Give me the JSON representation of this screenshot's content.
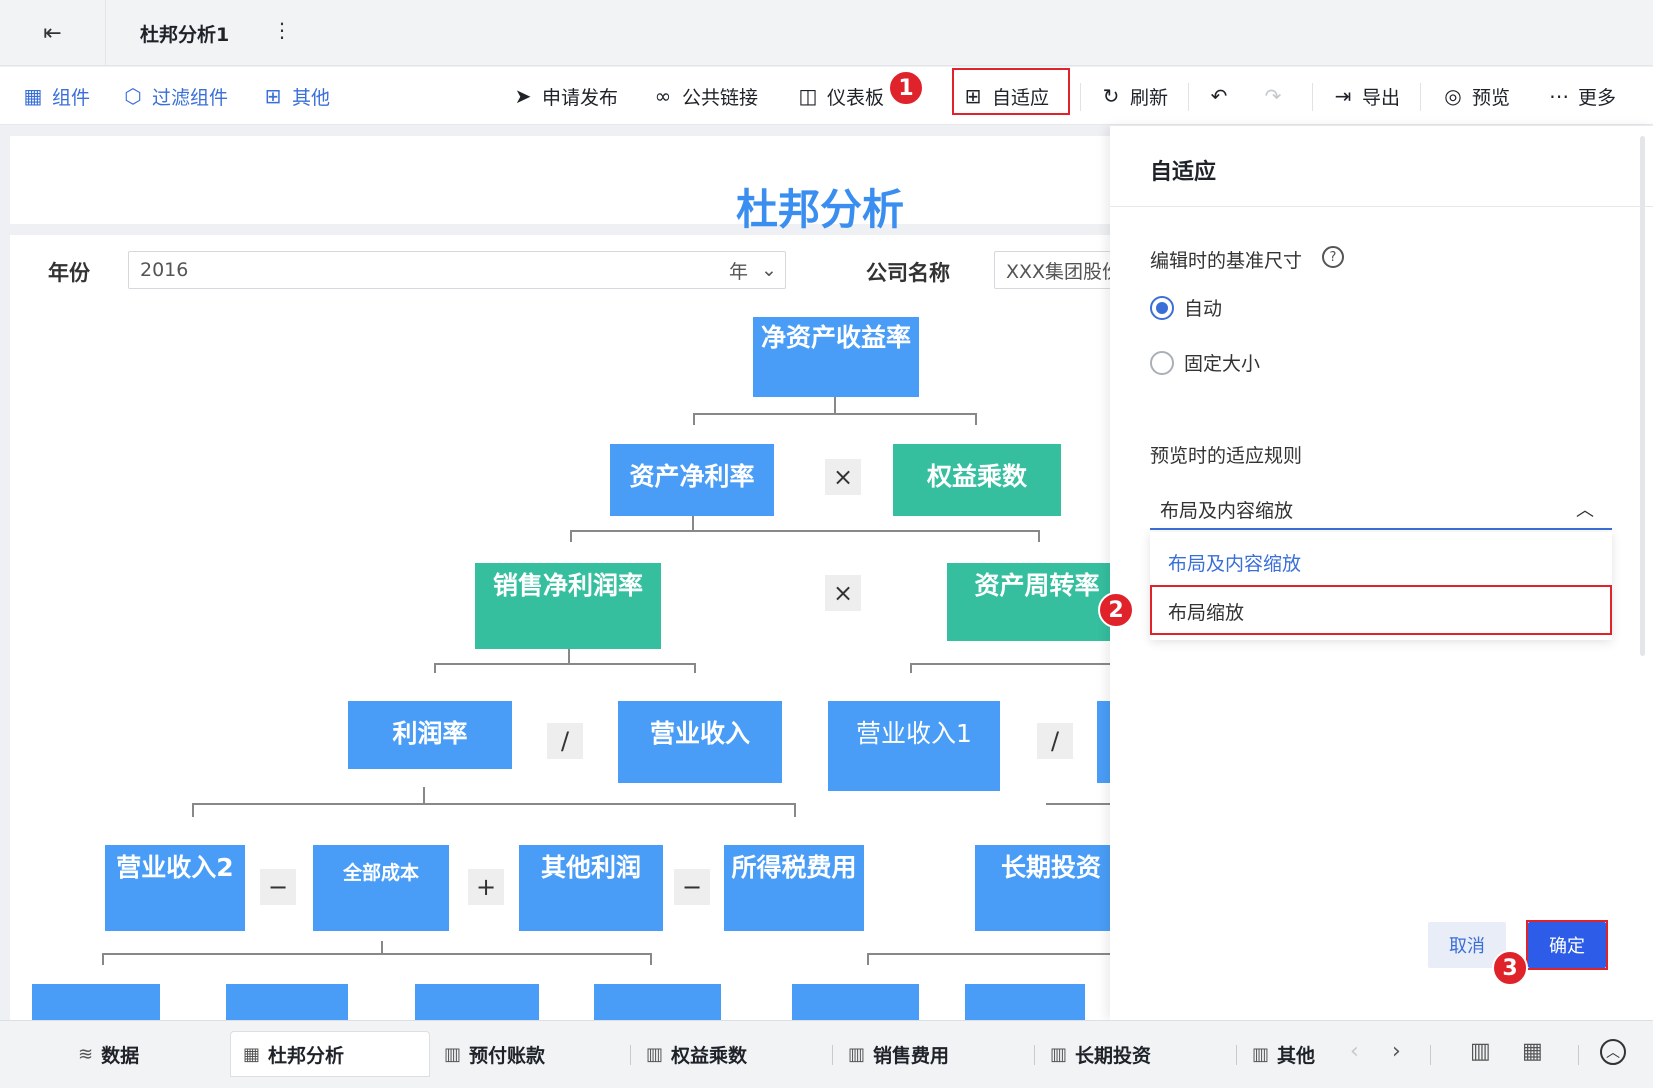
{
  "titlebar": {
    "back_icon": "exit-icon",
    "doc_title": "杜邦分析1",
    "more": "⋮"
  },
  "toolbar": {
    "components": "组件",
    "filter_components": "过滤组件",
    "others": "其他",
    "publish": "申请发布",
    "public_link": "公共链接",
    "dashboard": "仪表板",
    "adaptive": "自适应",
    "refresh": "刷新",
    "export": "导出",
    "preview": "预览",
    "more": "更多"
  },
  "report": {
    "title": "杜邦分析",
    "filters": {
      "year_label": "年份",
      "year_value": "2016",
      "year_unit": "年",
      "company_label": "公司名称",
      "company_value": "XXX集团股份"
    },
    "nodes": {
      "roe": "净资产收益率",
      "roa": "资产净利率",
      "equity_multiplier": "权益乘数",
      "net_margin": "销售净利润率",
      "asset_turnover": "资产周转率",
      "profit_rate": "利润率",
      "revenue": "营业收入",
      "revenue1": "营业收入1",
      "revenue2": "营业收入2",
      "total_cost": "全部成本",
      "other_profit": "其他利润",
      "income_tax": "所得税费用",
      "lt_invest": "长期投资"
    },
    "ops": {
      "multiply": "×",
      "divide": "/",
      "minus": "−",
      "plus": "+"
    }
  },
  "panel": {
    "title": "自适应",
    "base_size_label": "编辑时的基准尺寸",
    "radio_auto": "自动",
    "radio_fixed": "固定大小",
    "preview_rule_label": "预览时的适应规则",
    "select_value": "布局及内容缩放",
    "options": [
      "布局及内容缩放",
      "布局缩放"
    ],
    "cancel": "取消",
    "confirm": "确定"
  },
  "steps": [
    "1",
    "2",
    "3"
  ],
  "bottom_tabs": [
    "数据",
    "杜邦分析",
    "预付账款",
    "权益乘数",
    "销售费用",
    "长期投资",
    "其他"
  ],
  "colors": {
    "accent": "#3a6fd8",
    "node_blue": "#4a9df7",
    "node_green": "#36bf9f",
    "highlight": "#e0222a"
  }
}
